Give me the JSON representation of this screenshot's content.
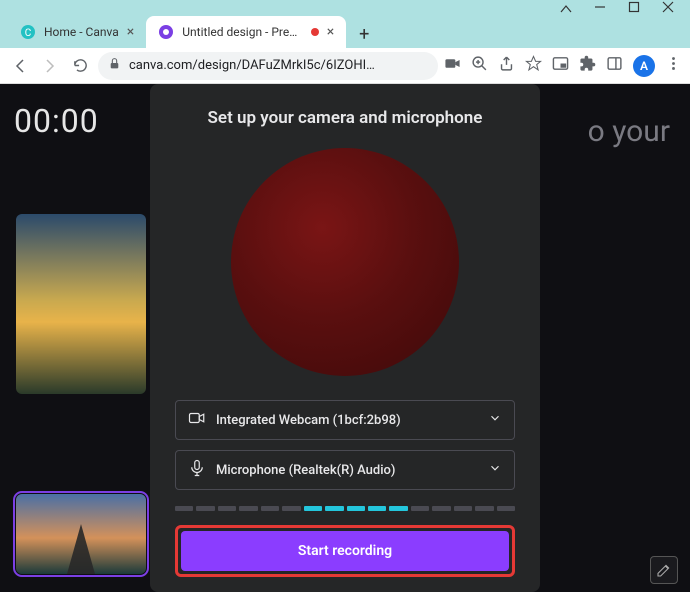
{
  "window": {
    "tabs": [
      {
        "title": "Home - Canva",
        "active": false
      },
      {
        "title": "Untitled design - Presen",
        "active": true,
        "recording": true
      }
    ]
  },
  "browser": {
    "url": "canva.com/design/DAFuZMrkI5c/6IZOHI…",
    "avatar_letter": "A"
  },
  "page": {
    "timer": "00:00",
    "background_text_fragment": "o your"
  },
  "modal": {
    "title": "Set up your camera and microphone",
    "camera": {
      "label": "Integrated Webcam (1bcf:2b98)"
    },
    "microphone": {
      "label": "Microphone (Realtek(R) Audio)"
    },
    "audio_meter": {
      "segments": 16,
      "active_start": 6,
      "active_end": 10
    },
    "start_button": "Start recording"
  }
}
